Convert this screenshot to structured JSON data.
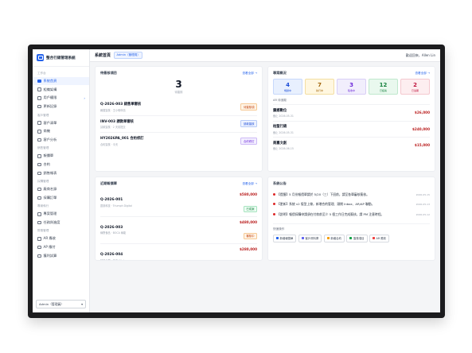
{
  "app": {
    "brand": "整合行銷管理系統"
  },
  "topbar": {
    "title": "系統首頁",
    "role_badge": "Admin（管理員）",
    "user": "歡迎回來，Allen Lin"
  },
  "sidebar": {
    "sections": [
      {
        "label": "工作台",
        "items": [
          {
            "label": "系統首頁",
            "active": true
          },
          {
            "label": "組織架構"
          },
          {
            "label": "用戶權限",
            "chevron": "›"
          },
          {
            "label": "更新記錄"
          }
        ]
      },
      {
        "label": "客戶管理",
        "items": [
          {
            "label": "客戶清單"
          },
          {
            "label": "商機"
          },
          {
            "label": "客戶分析"
          }
        ]
      },
      {
        "label": "銷售管理",
        "items": [
          {
            "label": "報價單"
          },
          {
            "label": "合約"
          },
          {
            "label": "銷售報表"
          }
        ]
      },
      {
        "label": "採購管理",
        "items": [
          {
            "label": "廠商名錄"
          },
          {
            "label": "採購訂單"
          }
        ]
      },
      {
        "label": "專案執行",
        "items": [
          {
            "label": "專案管理"
          },
          {
            "label": "任務與進度"
          }
        ]
      },
      {
        "label": "財務管理",
        "items": [
          {
            "label": "AR 應收"
          },
          {
            "label": "AP 應付"
          },
          {
            "label": "獲利試算"
          }
        ]
      }
    ],
    "role_select": "Admin（管理員）",
    "role_chevron": "▾"
  },
  "approvals": {
    "title": "待簽核項目",
    "link": "查看全部 →",
    "count": "3",
    "count_label": "待簽核",
    "rows": [
      {
        "title": "Q-2026-003 銷售單審核",
        "sub": "報價簽核 · 王小明申請",
        "tag": "待簽核項",
        "tag_color": "orange"
      },
      {
        "title": "INV-003 請款單審核",
        "sub": "請款簽核 · 2 天前提交",
        "tag": "請款簽核",
        "tag_color": "blue"
      },
      {
        "title": "HY2026PA_001 合約修訂",
        "sub": "合約簽核 · 今天",
        "tag": "合約修訂",
        "tag_color": "purple"
      }
    ]
  },
  "projects": {
    "title": "專案概況",
    "link": "查看全部 →",
    "stats": [
      {
        "num": "4",
        "label": "規劃中",
        "color": "s-blue"
      },
      {
        "num": "7",
        "label": "執行中",
        "color": "s-yellow"
      },
      {
        "num": "3",
        "label": "驗收中",
        "color": "s-purple"
      },
      {
        "num": "12",
        "label": "已結案",
        "color": "s-green"
      },
      {
        "num": "2",
        "label": "已逾期",
        "color": "s-red"
      }
    ],
    "ar_title": "AR 待追蹤",
    "ar_rows": [
      {
        "name": "震撼數位",
        "sub": "截止 2026-05-31",
        "amount": "$26,000"
      },
      {
        "name": "柏聖行銷",
        "sub": "截止 2026-05-31",
        "amount": "$240,000"
      },
      {
        "name": "商嘉文創",
        "sub": "截止 2026-06-15",
        "amount": "$15,000"
      }
    ]
  },
  "recent_quotes": {
    "title": "近期報價單",
    "link": "查看全部 →",
    "rows": [
      {
        "id": "Q-2026-001",
        "sub": "震撼科技 · Triumph Digital",
        "amount": "$580,000",
        "tag": "已成案",
        "tag_color": "green"
      },
      {
        "id": "Q-2026-003",
        "sub": "綠野食品 · BOCA 綠能",
        "amount": "$480,000",
        "tag": "審核中",
        "tag_color": "orange"
      },
      {
        "id": "Q-2026-004",
        "sub": "某某企業 · 商嘉 Kitchen",
        "amount": "$280,000",
        "tag": "草稿",
        "tag_color": "blue"
      }
    ]
  },
  "bulletins": {
    "title": "系統公告",
    "items": [
      {
        "text": "【提醒】5 月份報價單請於 5/20（三）下班前，請至各單審核簽核。",
        "date": "2026-05-15"
      },
      {
        "text": "【更新】系統 v2 版型上線，新增合約管理、頭期 Inbox、AR/AP 聯動。",
        "date": "2026-05-13"
      },
      {
        "text": "【說明】報價採購申請須在付款前至少 5 個工作日完成簽核，請 PM 注意時程。",
        "date": "2026-05-12"
      }
    ],
    "quick_title": "快速操作",
    "quick": [
      {
        "label": "新增報價單",
        "color": "#2563eb"
      },
      {
        "label": "客戶資料庫",
        "color": "#6366f1"
      },
      {
        "label": "新增合約",
        "color": "#f59e0b"
      },
      {
        "label": "簽核項目",
        "color": "#16a34a"
      },
      {
        "label": "AR 應收",
        "color": "#ef4444"
      }
    ]
  }
}
